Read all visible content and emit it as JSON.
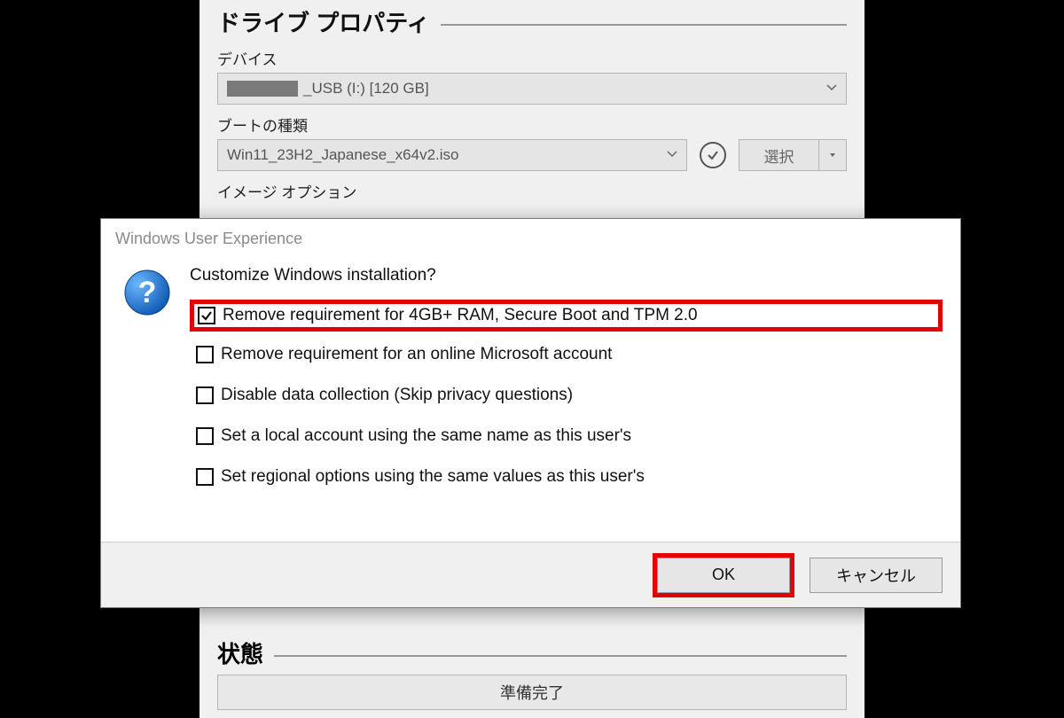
{
  "rufus": {
    "drive_properties_title": "ドライブ プロパティ",
    "device_label": "デバイス",
    "device_value": "_USB (I:) [120 GB]",
    "boot_label": "ブートの種類",
    "boot_value": "Win11_23H2_Japanese_x64v2.iso",
    "select_label": "選択",
    "image_option_label": "イメージ オプション",
    "status_title": "状態",
    "status_value": "準備完了"
  },
  "dialog": {
    "title": "Windows User Experience",
    "prompt": "Customize Windows installation?",
    "options": [
      {
        "label": "Remove requirement for 4GB+ RAM, Secure Boot and TPM 2.0",
        "checked": true,
        "highlight": true
      },
      {
        "label": "Remove requirement for an online Microsoft account",
        "checked": false,
        "highlight": false
      },
      {
        "label": "Disable data collection (Skip privacy questions)",
        "checked": false,
        "highlight": false
      },
      {
        "label": "Set a local account using the same name as this user's",
        "checked": false,
        "highlight": false
      },
      {
        "label": "Set regional options using the same values as this user's",
        "checked": false,
        "highlight": false
      }
    ],
    "ok_label": "OK",
    "cancel_label": "キャンセル"
  }
}
